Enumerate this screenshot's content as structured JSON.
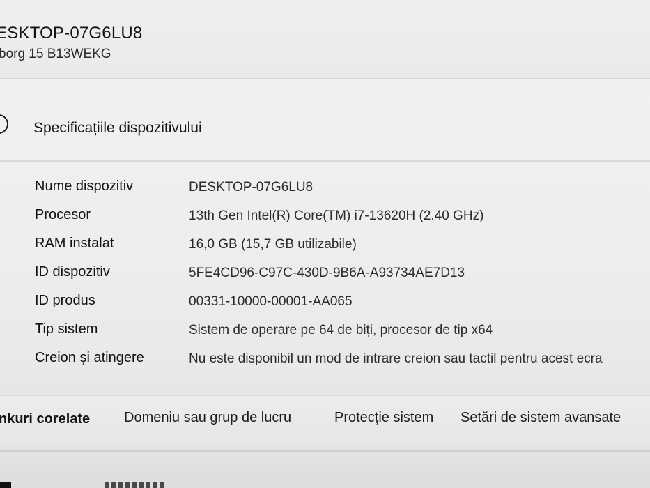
{
  "header": {
    "device_name": "ESKTOP-07G6LU8",
    "device_model": "borg 15 B13WEKG"
  },
  "device_specs": {
    "title": "Specificațiile dispozitivului",
    "icon": "info-circle-icon",
    "rows": [
      {
        "label": "Nume dispozitiv",
        "value": "DESKTOP-07G6LU8"
      },
      {
        "label": "Procesor",
        "value": "13th Gen Intel(R) Core(TM) i7-13620H (2.40 GHz)"
      },
      {
        "label": "RAM instalat",
        "value": "16,0 GB (15,7 GB utilizabile)"
      },
      {
        "label": "ID dispozitiv",
        "value": "5FE4CD96-C97C-430D-9B6A-A93734AE7D13"
      },
      {
        "label": "ID produs",
        "value": "00331-10000-00001-AA065"
      },
      {
        "label": "Tip sistem",
        "value": "Sistem de operare pe 64 de biți, procesor de tip x64"
      },
      {
        "label": "Creion și atingere",
        "value": "Nu este disponibil un mod de intrare creion sau tactil pentru acest ecra"
      }
    ]
  },
  "related_links": {
    "label": "nkuri corelate",
    "links": [
      "Domeniu sau grup de lucru",
      "Protecție sistem",
      "Setări de sistem avansate"
    ]
  }
}
